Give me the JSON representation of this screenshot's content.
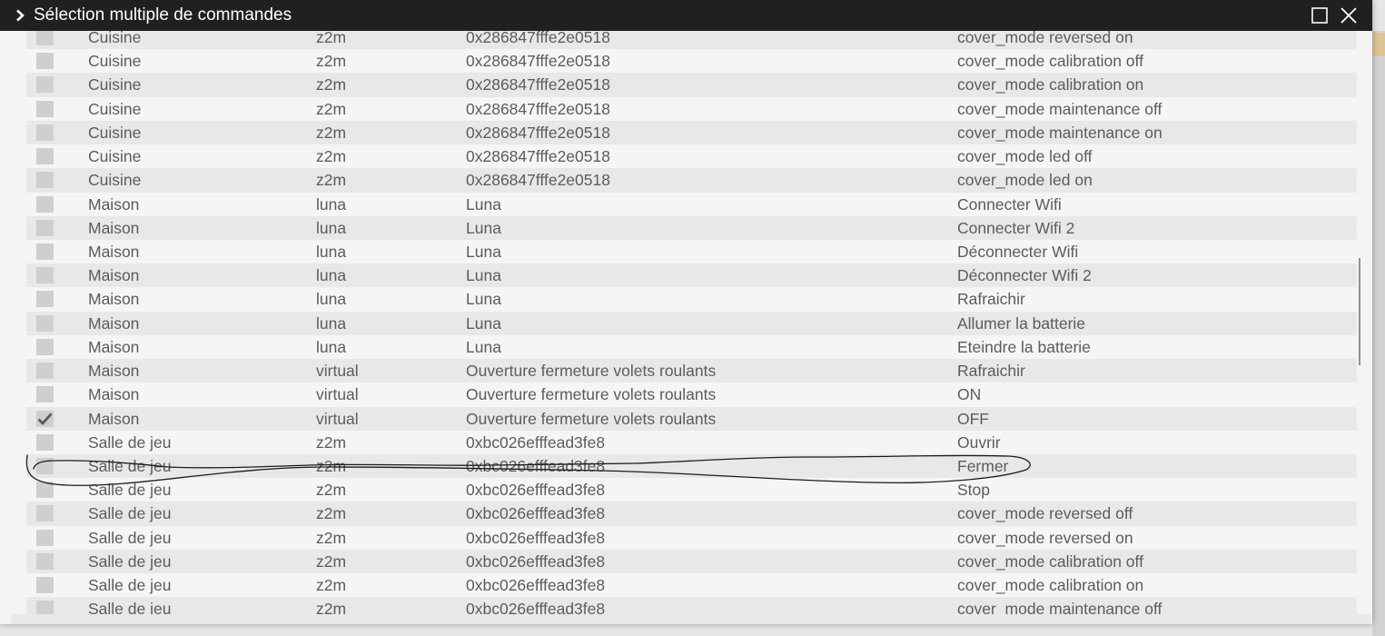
{
  "window": {
    "title": "Sélection multiple de commandes",
    "icons": {
      "expand": "chevron-right-icon",
      "maximize": "maximize-icon",
      "close": "close-icon"
    }
  },
  "colors": {
    "titlebar": "#202020",
    "row_odd": "#e8e8e8",
    "row_even": "#f5f5f5",
    "text": "#5c5c5c",
    "checkbox": "#cfcfcf"
  },
  "rows": [
    {
      "object": "Cuisine",
      "type": "z2m",
      "equipment": "0x286847fffe2e0518",
      "command": "cover_mode reversed on",
      "checked": false
    },
    {
      "object": "Cuisine",
      "type": "z2m",
      "equipment": "0x286847fffe2e0518",
      "command": "cover_mode calibration off",
      "checked": false
    },
    {
      "object": "Cuisine",
      "type": "z2m",
      "equipment": "0x286847fffe2e0518",
      "command": "cover_mode calibration on",
      "checked": false
    },
    {
      "object": "Cuisine",
      "type": "z2m",
      "equipment": "0x286847fffe2e0518",
      "command": "cover_mode maintenance off",
      "checked": false
    },
    {
      "object": "Cuisine",
      "type": "z2m",
      "equipment": "0x286847fffe2e0518",
      "command": "cover_mode maintenance on",
      "checked": false
    },
    {
      "object": "Cuisine",
      "type": "z2m",
      "equipment": "0x286847fffe2e0518",
      "command": "cover_mode led off",
      "checked": false
    },
    {
      "object": "Cuisine",
      "type": "z2m",
      "equipment": "0x286847fffe2e0518",
      "command": "cover_mode led on",
      "checked": false
    },
    {
      "object": "Maison",
      "type": "luna",
      "equipment": "Luna",
      "command": "Connecter Wifi",
      "checked": false
    },
    {
      "object": "Maison",
      "type": "luna",
      "equipment": "Luna",
      "command": "Connecter Wifi 2",
      "checked": false
    },
    {
      "object": "Maison",
      "type": "luna",
      "equipment": "Luna",
      "command": "Déconnecter Wifi",
      "checked": false
    },
    {
      "object": "Maison",
      "type": "luna",
      "equipment": "Luna",
      "command": "Déconnecter Wifi 2",
      "checked": false
    },
    {
      "object": "Maison",
      "type": "luna",
      "equipment": "Luna",
      "command": "Rafraichir",
      "checked": false
    },
    {
      "object": "Maison",
      "type": "luna",
      "equipment": "Luna",
      "command": "Allumer la batterie",
      "checked": false
    },
    {
      "object": "Maison",
      "type": "luna",
      "equipment": "Luna",
      "command": "Eteindre la batterie",
      "checked": false
    },
    {
      "object": "Maison",
      "type": "virtual",
      "equipment": "Ouverture fermeture volets roulants",
      "command": "Rafraichir",
      "checked": false
    },
    {
      "object": "Maison",
      "type": "virtual",
      "equipment": "Ouverture fermeture volets roulants",
      "command": "ON",
      "checked": false
    },
    {
      "object": "Maison",
      "type": "virtual",
      "equipment": "Ouverture fermeture volets roulants",
      "command": "OFF",
      "checked": true
    },
    {
      "object": "Salle de jeu",
      "type": "z2m",
      "equipment": "0xbc026efffead3fe8",
      "command": "Ouvrir",
      "checked": false
    },
    {
      "object": "Salle de jeu",
      "type": "z2m",
      "equipment": "0xbc026efffead3fe8",
      "command": "Fermer",
      "checked": false
    },
    {
      "object": "Salle de jeu",
      "type": "z2m",
      "equipment": "0xbc026efffead3fe8",
      "command": "Stop",
      "checked": false
    },
    {
      "object": "Salle de jeu",
      "type": "z2m",
      "equipment": "0xbc026efffead3fe8",
      "command": "cover_mode reversed off",
      "checked": false
    },
    {
      "object": "Salle de jeu",
      "type": "z2m",
      "equipment": "0xbc026efffead3fe8",
      "command": "cover_mode reversed on",
      "checked": false
    },
    {
      "object": "Salle de jeu",
      "type": "z2m",
      "equipment": "0xbc026efffead3fe8",
      "command": "cover_mode calibration off",
      "checked": false
    },
    {
      "object": "Salle de jeu",
      "type": "z2m",
      "equipment": "0xbc026efffead3fe8",
      "command": "cover_mode calibration on",
      "checked": false
    },
    {
      "object": "Salle de jeu",
      "type": "z2m",
      "equipment": "0xbc026efffead3fe8",
      "command": "cover_mode maintenance off",
      "checked": false
    }
  ]
}
